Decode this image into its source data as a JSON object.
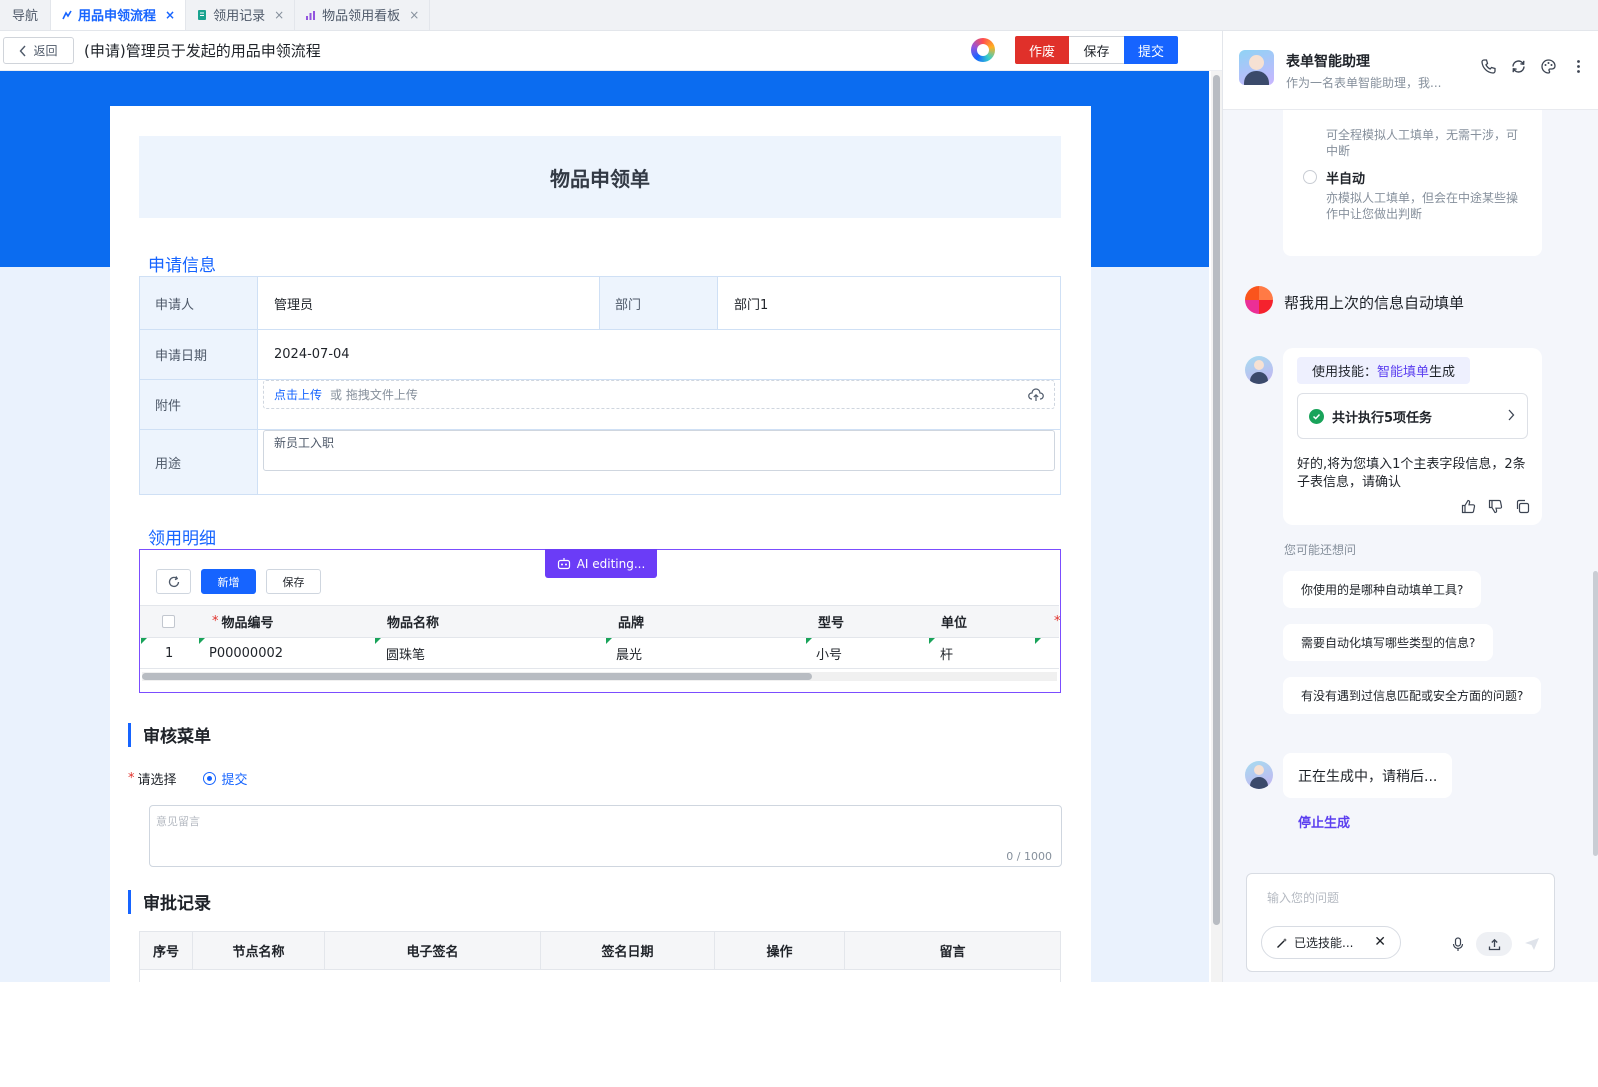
{
  "tabs": {
    "nav_label": "导航",
    "items": [
      {
        "label": "用品申领流程",
        "active": true
      },
      {
        "label": "领用记录",
        "active": false
      },
      {
        "label": "物品领用看板",
        "active": false
      }
    ],
    "close_glyph": "×"
  },
  "header": {
    "back_label": "返回",
    "title": "(申请)管理员于发起的用品申领流程",
    "void_label": "作废",
    "save_label": "保存",
    "submit_label": "提交"
  },
  "form": {
    "title": "物品申领单",
    "apply_section": "申请信息",
    "fields": {
      "applicant_label": "申请人",
      "applicant_value": "管理员",
      "dept_label": "部门",
      "dept_value": "部门1",
      "date_label": "申请日期",
      "date_value": "2024-07-04",
      "attach_label": "附件",
      "upload_link": "点击上传",
      "upload_hint": "或 拖拽文件上传",
      "purpose_label": "用途",
      "purpose_value": "新员工入职"
    },
    "detail_section": "领用明细",
    "ai_badge": "AI editing...",
    "toolbar": {
      "add_label": "新增",
      "save_label": "保存"
    },
    "columns": [
      "物品编号",
      "物品名称",
      "品牌",
      "型号",
      "单位"
    ],
    "rows": [
      {
        "index": "1",
        "code": "P00000002",
        "name": "圆珠笔",
        "brand": "晨光",
        "model": "小号",
        "unit": "杆"
      }
    ],
    "review_section": "审核菜单",
    "choice_label": "请选择",
    "choice_option": "提交",
    "opinion_placeholder": "意见留言",
    "opinion_count": "0 / 1000",
    "record_section": "审批记录",
    "record_columns": [
      "序号",
      "节点名称",
      "电子签名",
      "签名日期",
      "操作",
      "留言"
    ]
  },
  "assistant": {
    "title": "表单智能助理",
    "subtitle": "作为一名表单智能助理，我...",
    "mode_full_desc": "可全程模拟人工填单，无需干涉，可中断",
    "mode_semi_name": "半自动",
    "mode_semi_desc": "亦模拟人工填单，但会在中途某些操作中让您做出判断",
    "user_message": "帮我用上次的信息自动填单",
    "skill_prefix": "使用技能：",
    "skill_name": "智能填单",
    "skill_suffix": "生成",
    "task_summary": "共计执行5项任务",
    "bot_reply": "好的,将为您填入1个主表字段信息，2条子表信息，请确认",
    "maybe_ask": "您可能还想问",
    "suggestions": [
      "你使用的是哪种自动填单工具?",
      "需要自动化填写哪些类型的信息?",
      "有没有遇到过信息匹配或安全方面的问题?"
    ],
    "generating": "正在生成中，请稍后...",
    "stop_label": "停止生成",
    "input_placeholder": "输入您的问题",
    "selected_skill": "已选技能...",
    "accent": "#5b3ff0"
  }
}
